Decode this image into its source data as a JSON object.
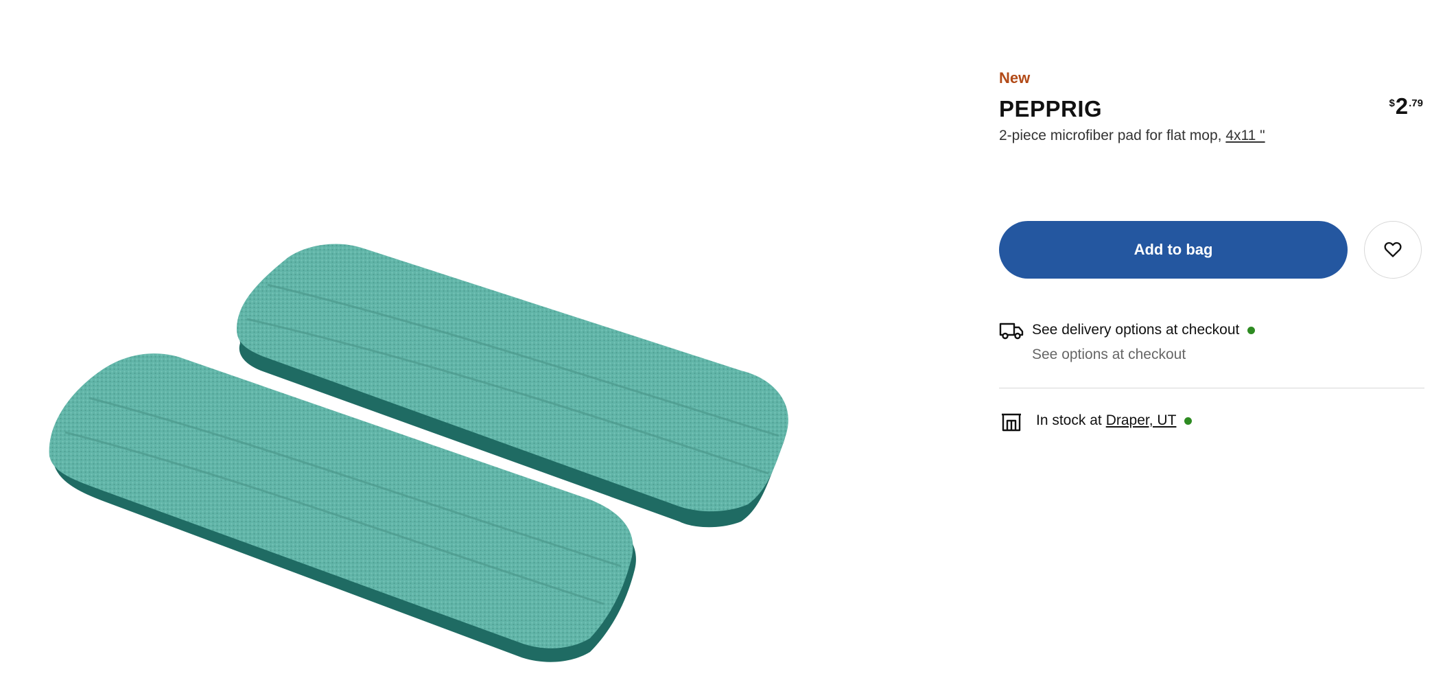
{
  "product": {
    "badge": "New",
    "name": "PEPPRIG",
    "description": "2-piece microfiber pad for flat mop,",
    "size_link": "4x11 \"",
    "price": {
      "currency": "$",
      "integer": "2",
      "decimal": ".79"
    },
    "image_alt": "microfiber-pads-image"
  },
  "actions": {
    "add_to_bag_label": "Add to bag",
    "favorite_icon": "heart-icon"
  },
  "delivery": {
    "icon": "truck-icon",
    "title": "See delivery options at checkout",
    "subtitle": "See options at checkout",
    "status_color": "#2e8b22"
  },
  "stock": {
    "icon": "store-icon",
    "prefix": "In stock at",
    "store": "Draper, UT",
    "status_color": "#2e8b22"
  },
  "colors": {
    "badge": "#b24a17",
    "primary_button": "#2457a0",
    "pad_main": "#5fb3a6",
    "pad_edge": "#1f6b63"
  }
}
